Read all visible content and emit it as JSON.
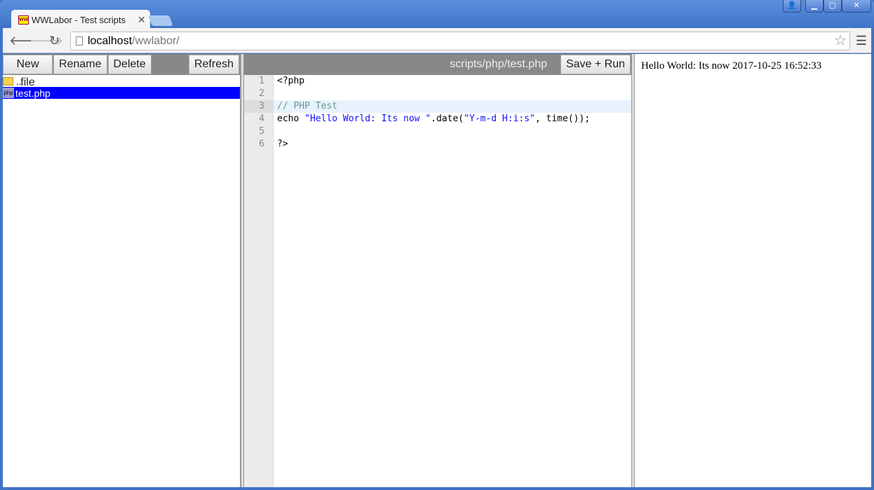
{
  "browser": {
    "tab_title": "WWLabor - Test scripts",
    "favicon_text": "WW",
    "url_host": "localhost",
    "url_path": "/wwlabor/"
  },
  "filepanel": {
    "buttons": [
      "New file",
      "Rename",
      "Delete",
      "Refresh"
    ],
    "items": [
      {
        "name": "..",
        "icon": "folder-icon"
      },
      {
        "name": "test.php",
        "icon": "php-file-icon",
        "icon_text": "php",
        "selected": true
      }
    ]
  },
  "editor": {
    "filename": "scripts/php/test.php",
    "save_run_label": "Save + Run",
    "active_line": 3,
    "lines": [
      {
        "n": "1",
        "text": "<?php"
      },
      {
        "n": "2",
        "text": ""
      },
      {
        "n": "3",
        "text": "// PHP Test"
      },
      {
        "n": "4",
        "pre": "echo ",
        "s1": "\"Hello World: Its now \"",
        "mid": ".date(",
        "s2": "\"Y-m-d H:i:s\"",
        "post": ", time());"
      },
      {
        "n": "5",
        "text": ""
      },
      {
        "n": "6",
        "text": "?>"
      }
    ]
  },
  "output": {
    "text": "Hello World: Its now 2017-10-25 16:52:33"
  },
  "colors": {
    "selection": "#0000ff",
    "string": "#1111ff",
    "comment": "#6a9a8a",
    "bar": "#888888"
  }
}
